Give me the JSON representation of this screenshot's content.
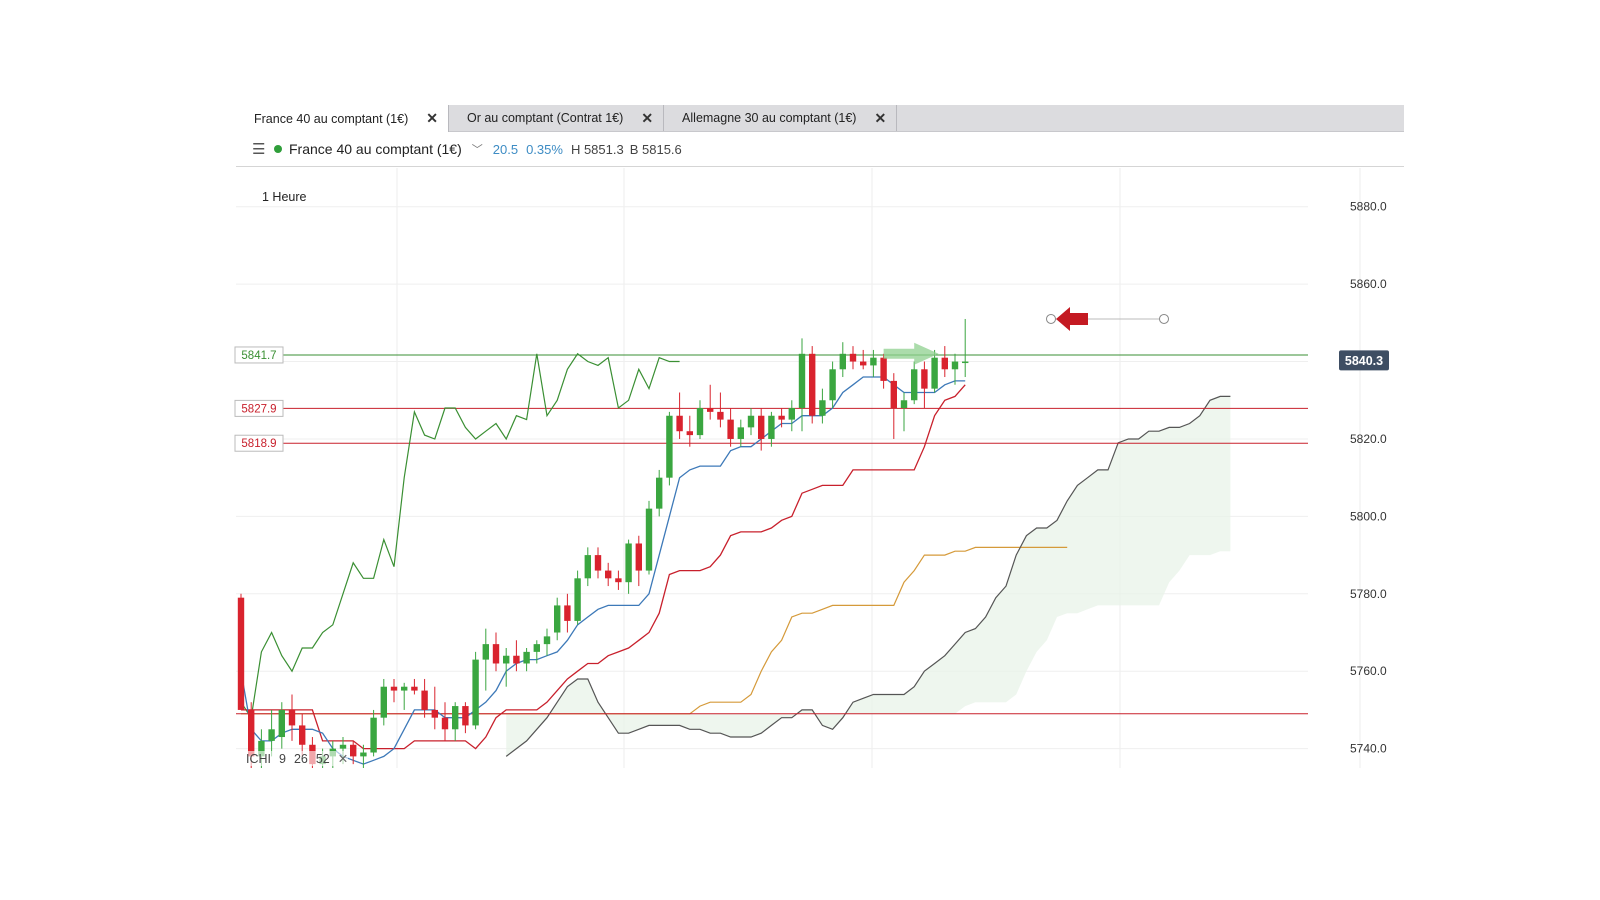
{
  "tabs": [
    {
      "label": "France 40 au comptant (1€)",
      "active": true
    },
    {
      "label": "Or au comptant (Contrat 1€)",
      "active": false
    },
    {
      "label": "Allemagne 30 au comptant (1€)",
      "active": false
    }
  ],
  "header": {
    "instrument": "France 40 au comptant (1€)",
    "change": "20.5",
    "change_pct": "0.35%",
    "high": "H 5851.3",
    "bid": "B 5815.6",
    "status_color": "#2f9e3a"
  },
  "timeframe": "1 Heure",
  "indicator": {
    "name": "ICHI",
    "p1": "9",
    "p2": "26",
    "p3": "52",
    "close": "✕"
  },
  "colors": {
    "up": "#3aa640",
    "down": "#d9232e",
    "tenkan": "#3d79b8",
    "kijun": "#c8202c",
    "chikou": "#3a8f33",
    "spanA": "#555555",
    "spanB": "#d59a3a",
    "cloud": "#e8f3e8"
  },
  "chart_data": {
    "type": "candlestick",
    "ylim": [
      5735,
      5890
    ],
    "yticks": [
      "5880.0",
      "5860.0",
      "5840.0",
      "5820.0",
      "5800.0",
      "5780.0",
      "5760.0",
      "5740.0"
    ],
    "current_price": "5840.3",
    "levels": [
      {
        "label": "5841.7",
        "value": 5841.7,
        "color": "#3a8f33"
      },
      {
        "label": "5827.9",
        "value": 5827.9,
        "color": "#c8202c"
      },
      {
        "label": "5818.9",
        "value": 5818.9,
        "color": "#c8202c"
      }
    ],
    "candles": [
      [
        5779,
        5780,
        5770,
        5750
      ],
      [
        5750,
        5752,
        5730,
        5738
      ],
      [
        5738,
        5745,
        5732,
        5742
      ],
      [
        5742,
        5750,
        5738,
        5745
      ],
      [
        5743,
        5752,
        5740,
        5750
      ],
      [
        5750,
        5754,
        5742,
        5746
      ],
      [
        5746,
        5749,
        5738,
        5741
      ],
      [
        5741,
        5743,
        5733,
        5736
      ],
      [
        5736,
        5740,
        5732,
        5738
      ],
      [
        5738,
        5742,
        5734,
        5740
      ],
      [
        5740,
        5743,
        5736,
        5741
      ],
      [
        5741,
        5742,
        5736,
        5738
      ],
      [
        5738,
        5741,
        5735,
        5739
      ],
      [
        5739,
        5750,
        5738,
        5748
      ],
      [
        5748,
        5758,
        5746,
        5756
      ],
      [
        5756,
        5758,
        5752,
        5755
      ],
      [
        5755,
        5757,
        5750,
        5756
      ],
      [
        5756,
        5758,
        5754,
        5755
      ],
      [
        5755,
        5758,
        5748,
        5750
      ],
      [
        5750,
        5756,
        5745,
        5748
      ],
      [
        5748,
        5752,
        5742,
        5745
      ],
      [
        5745,
        5752,
        5742,
        5751
      ],
      [
        5751,
        5752,
        5744,
        5746
      ],
      [
        5746,
        5765,
        5745,
        5763
      ],
      [
        5763,
        5771,
        5755,
        5767
      ],
      [
        5767,
        5770,
        5760,
        5762
      ],
      [
        5762,
        5766,
        5756,
        5764
      ],
      [
        5764,
        5768,
        5760,
        5762
      ],
      [
        5762,
        5766,
        5760,
        5765
      ],
      [
        5765,
        5768,
        5762,
        5767
      ],
      [
        5767,
        5771,
        5764,
        5769
      ],
      [
        5770,
        5779,
        5768,
        5777
      ],
      [
        5777,
        5780,
        5770,
        5773
      ],
      [
        5773,
        5786,
        5772,
        5784
      ],
      [
        5784,
        5792,
        5782,
        5790
      ],
      [
        5790,
        5792,
        5784,
        5786
      ],
      [
        5786,
        5788,
        5782,
        5784
      ],
      [
        5784,
        5786,
        5781,
        5783
      ],
      [
        5783,
        5794,
        5780,
        5793
      ],
      [
        5793,
        5795,
        5782,
        5786
      ],
      [
        5786,
        5804,
        5785,
        5802
      ],
      [
        5802,
        5812,
        5800,
        5810
      ],
      [
        5810,
        5827,
        5808,
        5826
      ],
      [
        5826,
        5832,
        5820,
        5822
      ],
      [
        5822,
        5826,
        5818,
        5821
      ],
      [
        5821,
        5830,
        5820,
        5828
      ],
      [
        5828,
        5834,
        5825,
        5827
      ],
      [
        5827,
        5832,
        5823,
        5825
      ],
      [
        5825,
        5828,
        5818,
        5820
      ],
      [
        5820,
        5825,
        5818,
        5823
      ],
      [
        5823,
        5828,
        5821,
        5826
      ],
      [
        5826,
        5828,
        5817,
        5820
      ],
      [
        5820,
        5827,
        5818,
        5826
      ],
      [
        5826,
        5828,
        5823,
        5825
      ],
      [
        5825,
        5830,
        5822,
        5828
      ],
      [
        5828,
        5846,
        5822,
        5842
      ],
      [
        5842,
        5844,
        5824,
        5826
      ],
      [
        5826,
        5833,
        5824,
        5830
      ],
      [
        5830,
        5840,
        5828,
        5838
      ],
      [
        5838,
        5845,
        5836,
        5842
      ],
      [
        5842,
        5844,
        5838,
        5840
      ],
      [
        5840,
        5843,
        5838,
        5839
      ],
      [
        5839,
        5843,
        5836,
        5841
      ],
      [
        5841,
        5842,
        5833,
        5835
      ],
      [
        5835,
        5837,
        5820,
        5828
      ],
      [
        5828,
        5832,
        5822,
        5830
      ],
      [
        5830,
        5840,
        5829,
        5838
      ],
      [
        5838,
        5840,
        5828,
        5833
      ],
      [
        5833,
        5843,
        5832,
        5841
      ],
      [
        5841,
        5844,
        5836,
        5838
      ],
      [
        5838,
        5842,
        5834,
        5840
      ],
      [
        5840,
        5851,
        5836,
        5840
      ]
    ],
    "tenkan": [
      5760,
      5745,
      5742,
      5742,
      5744,
      5745,
      5745,
      5745,
      5744,
      5740,
      5738,
      5737,
      5736,
      5737,
      5738,
      5740,
      5745,
      5750,
      5750,
      5750,
      5748,
      5748,
      5748,
      5750,
      5752,
      5755,
      5760,
      5762,
      5763,
      5763,
      5764,
      5765,
      5768,
      5772,
      5774,
      5776,
      5777,
      5777,
      5777,
      5777,
      5780,
      5790,
      5800,
      5810,
      5812,
      5813,
      5813,
      5813,
      5817,
      5818,
      5818,
      5820,
      5822,
      5824,
      5824,
      5826,
      5826,
      5826,
      5828,
      5832,
      5834,
      5836,
      5836,
      5836,
      5834,
      5832,
      5832,
      5832,
      5832,
      5834,
      5835,
      5835
    ],
    "kijun": [
      5750,
      5750,
      5750,
      5750,
      5750,
      5750,
      5750,
      5750,
      5742,
      5742,
      5742,
      5742,
      5740,
      5740,
      5740,
      5740,
      5740,
      5742,
      5742,
      5742,
      5742,
      5742,
      5742,
      5740,
      5743,
      5748,
      5750,
      5750,
      5750,
      5750,
      5752,
      5755,
      5758,
      5760,
      5762,
      5762,
      5764,
      5765,
      5766,
      5768,
      5770,
      5775,
      5785,
      5786,
      5786,
      5786,
      5787,
      5790,
      5795,
      5796,
      5796,
      5796,
      5797,
      5799,
      5800,
      5806,
      5807,
      5808,
      5808,
      5808,
      5812,
      5812,
      5812,
      5812,
      5812,
      5812,
      5812,
      5818,
      5826,
      5830,
      5831,
      5834
    ],
    "chikou": [
      5752,
      5748,
      5765,
      5770,
      5764,
      5760,
      5766,
      5766,
      5770,
      5772,
      5780,
      5788,
      5784,
      5784,
      5794,
      5787,
      5810,
      5827,
      5821,
      5820,
      5828,
      5828,
      5823,
      5820,
      5822,
      5824,
      5820,
      5826,
      5825,
      5842,
      5826,
      5830,
      5838,
      5842,
      5840,
      5839,
      5841,
      5828,
      5830,
      5838,
      5833,
      5841,
      5840,
      5840
    ],
    "spanA": [
      5738,
      5740,
      5742,
      5745,
      5748,
      5752,
      5756,
      5758,
      5758,
      5752,
      5748,
      5744,
      5744,
      5745,
      5746,
      5746,
      5746,
      5746,
      5745,
      5745,
      5744,
      5744,
      5743,
      5743,
      5743,
      5744,
      5746,
      5748,
      5748,
      5750,
      5750,
      5746,
      5745,
      5748,
      5752,
      5753,
      5754,
      5754,
      5754,
      5754,
      5756,
      5760,
      5762,
      5764,
      5767,
      5770,
      5771,
      5774,
      5779,
      5782,
      5790,
      5795,
      5797,
      5797,
      5799,
      5804,
      5808,
      5810,
      5812,
      5812,
      5819,
      5820,
      5820,
      5822,
      5822,
      5823,
      5823,
      5824,
      5826,
      5830,
      5831,
      5831
    ],
    "spanB": [
      5749,
      5749,
      5749,
      5749,
      5749,
      5749,
      5749,
      5749,
      5749,
      5749,
      5749,
      5749,
      5749,
      5749,
      5749,
      5749,
      5749,
      5749,
      5749,
      5749,
      5749,
      5749,
      5749,
      5749,
      5749,
      5749,
      5749,
      5749,
      5749,
      5749,
      5749,
      5749,
      5749,
      5749,
      5749,
      5749,
      5749,
      5749,
      5749,
      5749,
      5749,
      5749,
      5749,
      5749,
      5749,
      5751,
      5752,
      5752,
      5752,
      5752,
      5754,
      5760,
      5765,
      5768,
      5774,
      5775,
      5775,
      5776,
      5777,
      5777,
      5777,
      5777,
      5777,
      5777,
      5777,
      5783,
      5786,
      5790,
      5790,
      5790,
      5791,
      5791,
      5792,
      5792,
      5792,
      5792,
      5792,
      5792,
      5792,
      5792,
      5792,
      5792
    ]
  }
}
